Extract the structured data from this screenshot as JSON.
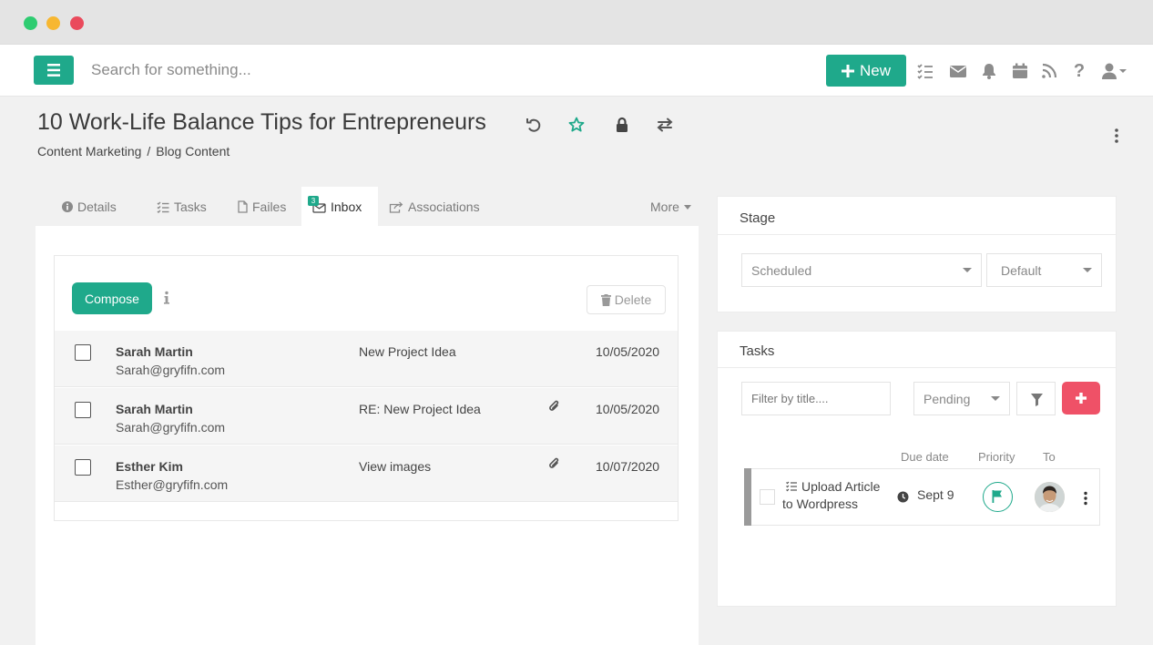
{
  "window": {
    "controls": [
      "close",
      "minimize",
      "maximize"
    ]
  },
  "topbar": {
    "search_placeholder": "Search for something...",
    "new_button": "New",
    "icons": [
      "tasks-icon",
      "mail-icon",
      "bell-icon",
      "calendar-icon",
      "rss-icon",
      "help-icon",
      "user-icon"
    ]
  },
  "page": {
    "title": "10 Work-Life Balance Tips for Entrepreneurs",
    "breadcrumb": [
      "Content Marketing",
      "Blog Content"
    ],
    "breadcrumb_separator": "/"
  },
  "tabs": [
    {
      "label": "Details",
      "icon": "info-icon"
    },
    {
      "label": "Tasks",
      "icon": "tasks-icon"
    },
    {
      "label": "Failes",
      "icon": "file-icon"
    },
    {
      "label": "Inbox",
      "icon": "inbox-icon",
      "badge": "3",
      "active": true
    },
    {
      "label": "Associations",
      "icon": "share-icon"
    }
  ],
  "more_label": "More",
  "inbox": {
    "compose_label": "Compose",
    "delete_label": "Delete",
    "messages": [
      {
        "name": "Sarah Martin",
        "email": "Sarah@gryfifn.com",
        "subject": "New Project Idea",
        "date": "10/05/2020",
        "attachment": false
      },
      {
        "name": "Sarah Martin",
        "email": "Sarah@gryfifn.com",
        "subject": "RE: New Project Idea",
        "date": "10/05/2020",
        "attachment": true
      },
      {
        "name": "Esther Kim",
        "email": "Esther@gryfifn.com",
        "subject": "View images",
        "date": "10/07/2020",
        "attachment": true
      }
    ]
  },
  "stage": {
    "title": "Stage",
    "stage_value": "Scheduled",
    "option_value": "Default"
  },
  "tasks_panel": {
    "title": "Tasks",
    "filter_placeholder": "Filter by title....",
    "status_value": "Pending",
    "columns": {
      "due": "Due date",
      "priority": "Priority",
      "to": "To"
    },
    "items": [
      {
        "title_line1": "Upload Article",
        "title_line2": "to Wordpress",
        "due": "Sept 9"
      }
    ]
  },
  "colors": {
    "accent": "#1fa98b",
    "danger": "#ef5167",
    "close": "#ea4a5c",
    "minimize": "#f7b731",
    "maximize": "#2ecc71"
  }
}
